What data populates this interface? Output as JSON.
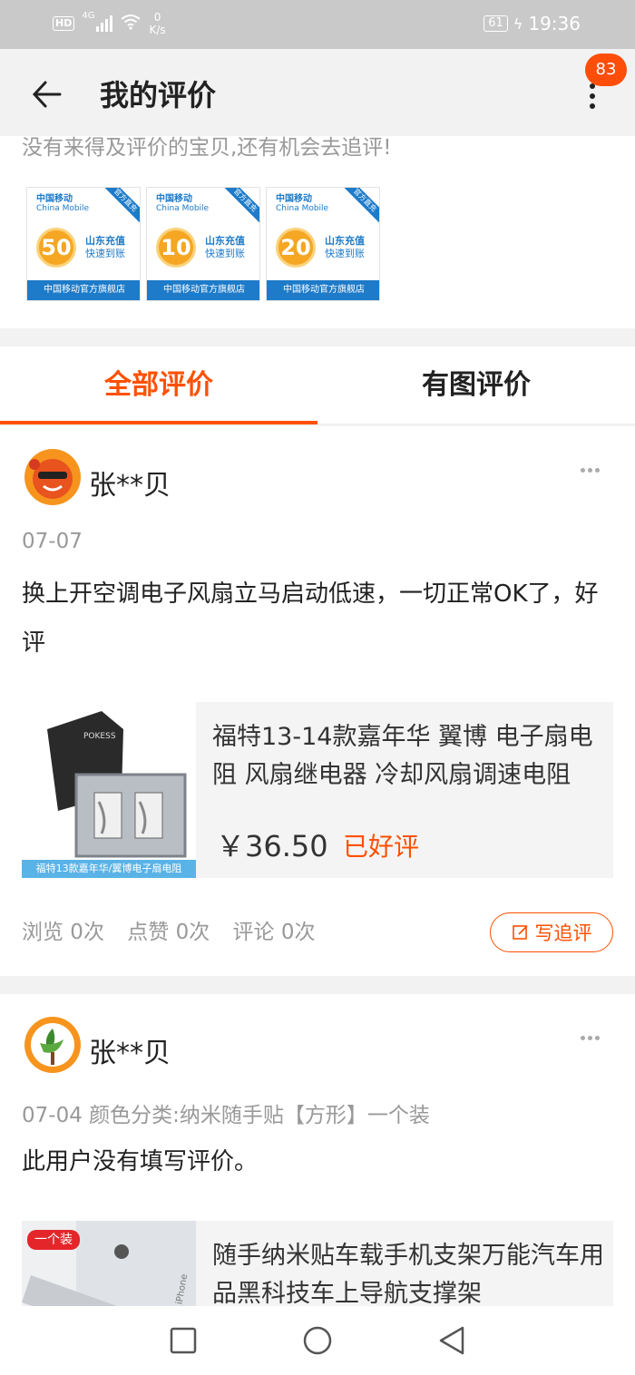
{
  "status_bar": {
    "hd": "HD",
    "network": "4G",
    "net_speed_value": "0",
    "net_speed_unit": "K/s",
    "battery": "61",
    "time": "19:36"
  },
  "header": {
    "title": "我的评价",
    "badge_count": "83"
  },
  "pending": {
    "hint": "没有来得及评价的宝贝,还有机会去追评!",
    "items": [
      {
        "brand": "中国移动",
        "brand_en": "China Mobile",
        "ribbon": "官方直充",
        "amount": "50",
        "line1": "山东充值",
        "line2": "快速到账",
        "store": "中国移动官方旗舰店"
      },
      {
        "brand": "中国移动",
        "brand_en": "China Mobile",
        "ribbon": "官方直充",
        "amount": "10",
        "line1": "山东充值",
        "line2": "快速到账",
        "store": "中国移动官方旗舰店"
      },
      {
        "brand": "中国移动",
        "brand_en": "China Mobile",
        "ribbon": "官方直充",
        "amount": "20",
        "line1": "山东充值",
        "line2": "快速到账",
        "store": "中国移动官方旗舰店"
      }
    ]
  },
  "tabs": [
    {
      "label": "全部评价"
    },
    {
      "label": "有图评价"
    }
  ],
  "reviews": [
    {
      "username": "张**贝",
      "meta": "07-07",
      "text": "换上开空调电子风扇立马启动低速，一切正常OK了，好评",
      "product_title": "福特13-14款嘉年华 翼博 电子扇电阻 风扇继电器 冷却风扇调速电阻",
      "product_img_caption": "福特13款嘉年华/翼博电子扇电阻",
      "product_img_brand": "POKESS",
      "price": "￥36.50",
      "status": "已好评",
      "stats": {
        "views": "浏览 0次",
        "likes": "点赞 0次",
        "comments": "评论 0次"
      },
      "followup_label": "写追评"
    },
    {
      "username": "张**贝",
      "meta": "07-04  颜色分类:纳米随手贴【方形】一个装",
      "text": "此用户没有填写评价。",
      "product_title": "随手纳米贴车载手机支架万能汽车用品黑科技车上导航支撑架",
      "product_img_tag": "一个装",
      "product_img_text": "iPhone"
    }
  ],
  "colors": {
    "accent": "#ff5000",
    "badge": "#ff4d0a",
    "china_mobile_blue": "#1d7bc9"
  }
}
